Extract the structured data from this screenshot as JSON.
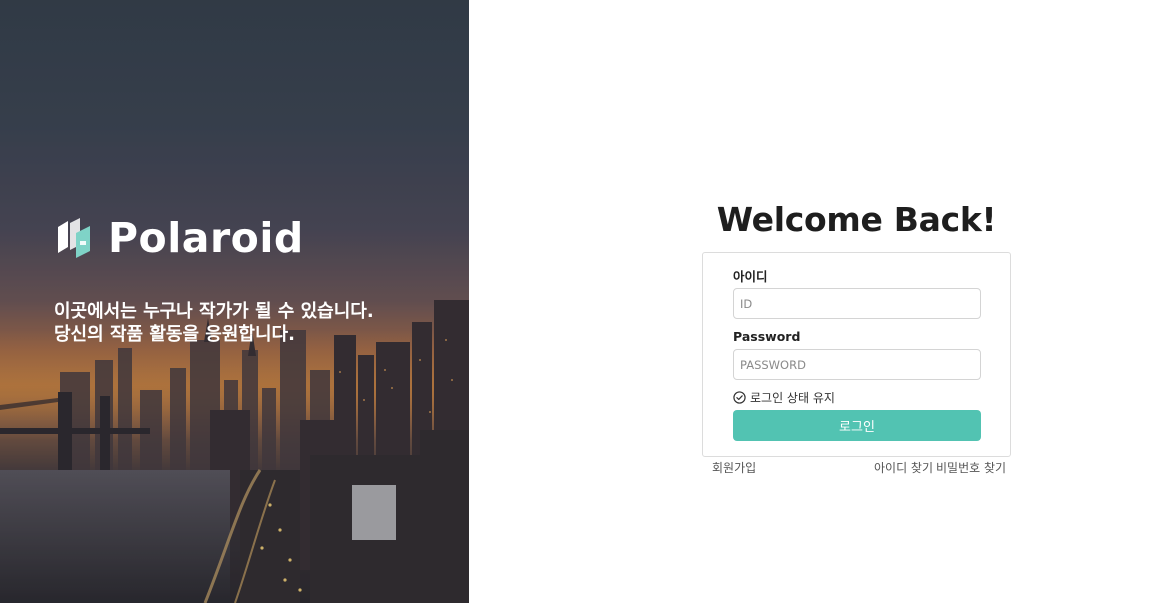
{
  "hero": {
    "brand_name": "Polaroid",
    "tagline_line1": "이곳에서는 누구나 작가가 될 수 있습니다.",
    "tagline_line2": "당신의 작품 활동을 응원합니다."
  },
  "login": {
    "title": "Welcome Back!",
    "id_label": "아이디",
    "id_placeholder": "ID",
    "password_label": "Password",
    "password_placeholder": "PASSWORD",
    "remember_label": "로그인 상태 유지",
    "submit_label": "로그인"
  },
  "links": {
    "signup": "회원가입",
    "find_id": "아이디 찾기",
    "find_password": "비밀번호 찾기"
  },
  "colors": {
    "accent": "#52c3b2",
    "title_text": "#1e1e1e",
    "border": "#dcdcdc"
  },
  "icons": {
    "brand": "polaroid-logo-icon",
    "remember": "check-circle-icon"
  }
}
